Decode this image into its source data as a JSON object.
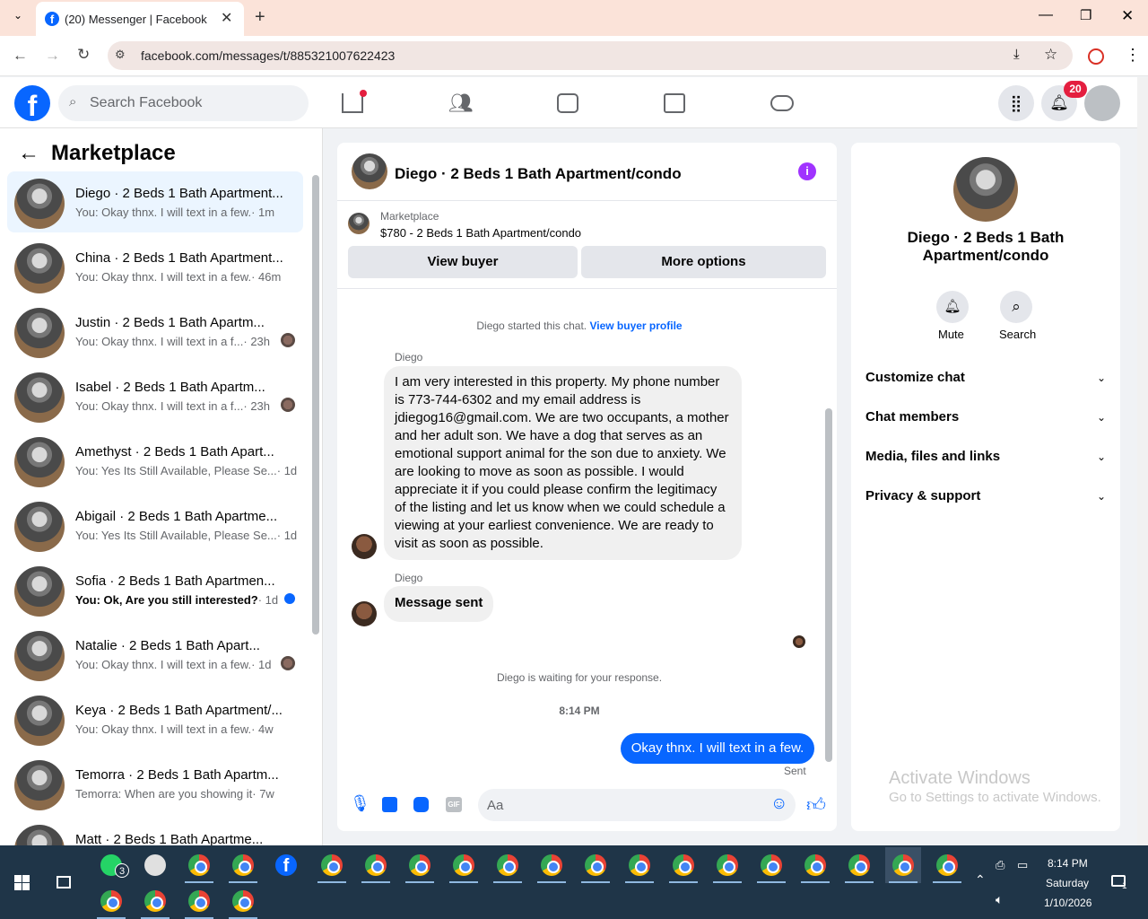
{
  "browser": {
    "tab_title": "(20) Messenger | Facebook",
    "url": "facebook.com/messages/t/885321007622423"
  },
  "fb": {
    "search_placeholder": "Search Facebook",
    "notif_count": "20"
  },
  "sidebar": {
    "title": "Marketplace",
    "items": [
      {
        "name": "Diego · 2 Beds 1 Bath Apartment...",
        "snippet": "You: Okay thnx. I will text in a few.",
        "time": "· 1m",
        "active": true,
        "bold": false
      },
      {
        "name": "China · 2 Beds 1 Bath Apartment...",
        "snippet": "You: Okay thnx. I will text in a few.",
        "time": "· 46m"
      },
      {
        "name": "Justin · 2 Beds 1 Bath Apartm...",
        "snippet": "You: Okay thnx. I will text in a f...",
        "time": "· 23h"
      },
      {
        "name": "Isabel · 2 Beds 1 Bath Apartm...",
        "snippet": "You: Okay thnx. I will text in a f...",
        "time": "· 23h"
      },
      {
        "name": "Amethyst · 2 Beds 1 Bath Apart...",
        "snippet": "You: Yes Its Still Available, Please Se...",
        "time": "· 1d"
      },
      {
        "name": "Abigail · 2 Beds 1 Bath Apartme...",
        "snippet": "You: Yes Its Still Available, Please Se...",
        "time": "· 1d"
      },
      {
        "name": "Sofia · 2 Beds 1 Bath Apartmen...",
        "snippet": "You: Ok, Are you still interested?",
        "time": "· 1d"
      },
      {
        "name": "Natalie · 2 Beds 1 Bath Apart...",
        "snippet": "You: Okay thnx. I will text in a few.",
        "time": "· 1d"
      },
      {
        "name": "Keya · 2 Beds 1 Bath Apartment/...",
        "snippet": "You: Okay thnx. I will text in a few.",
        "time": "· 4w"
      },
      {
        "name": "Temorra · 2 Beds 1 Bath Apartm...",
        "snippet": "Temorra: When are you showing it",
        "time": "· 7w"
      },
      {
        "name": "Matt · 2 Beds 1 Bath Apartme...",
        "snippet": "",
        "time": ""
      }
    ]
  },
  "chat": {
    "header_title": "Diego · 2 Beds 1 Bath Apartment/condo",
    "listing_label": "Marketplace",
    "listing_title": "$780 - 2 Beds 1 Bath Apartment/condo",
    "view_buyer": "View buyer",
    "more_options": "More options",
    "started_text": "Diego started this chat.",
    "view_buyer_profile": "View buyer profile",
    "sender1": "Diego",
    "msg1": "I am very interested in this property. My phone number is 773-744-6302 and my email address is jdiegog16@gmail.com. We are two occupants, a mother and her adult son. We have a dog that serves as an emotional support animal for the son due to anxiety. We are looking to move as soon as possible. I would appreciate it if you could please confirm the legitimacy of the listing and let us know when we could schedule a viewing at your earliest convenience. We are ready to visit as soon as possible.",
    "sender2": "Diego",
    "msg2": "Message sent",
    "waiting": "Diego is waiting for your response.",
    "timestamp": "8:14 PM",
    "out_msg": "Okay thnx. I will text in a few.",
    "sent": "Sent",
    "composer_placeholder": "Aa"
  },
  "details": {
    "title": "Diego · 2 Beds 1 Bath Apartment/condo",
    "mute": "Mute",
    "search": "Search",
    "sections": [
      "Customize chat",
      "Chat members",
      "Media, files and links",
      "Privacy & support"
    ]
  },
  "watermark": {
    "line1": "Activate Windows",
    "line2": "Go to Settings to activate Windows."
  },
  "taskbar": {
    "time": "8:14 PM",
    "day": "Saturday",
    "date": "1/10/2026",
    "whatsapp_badge": "3",
    "notif_badge": "1"
  }
}
